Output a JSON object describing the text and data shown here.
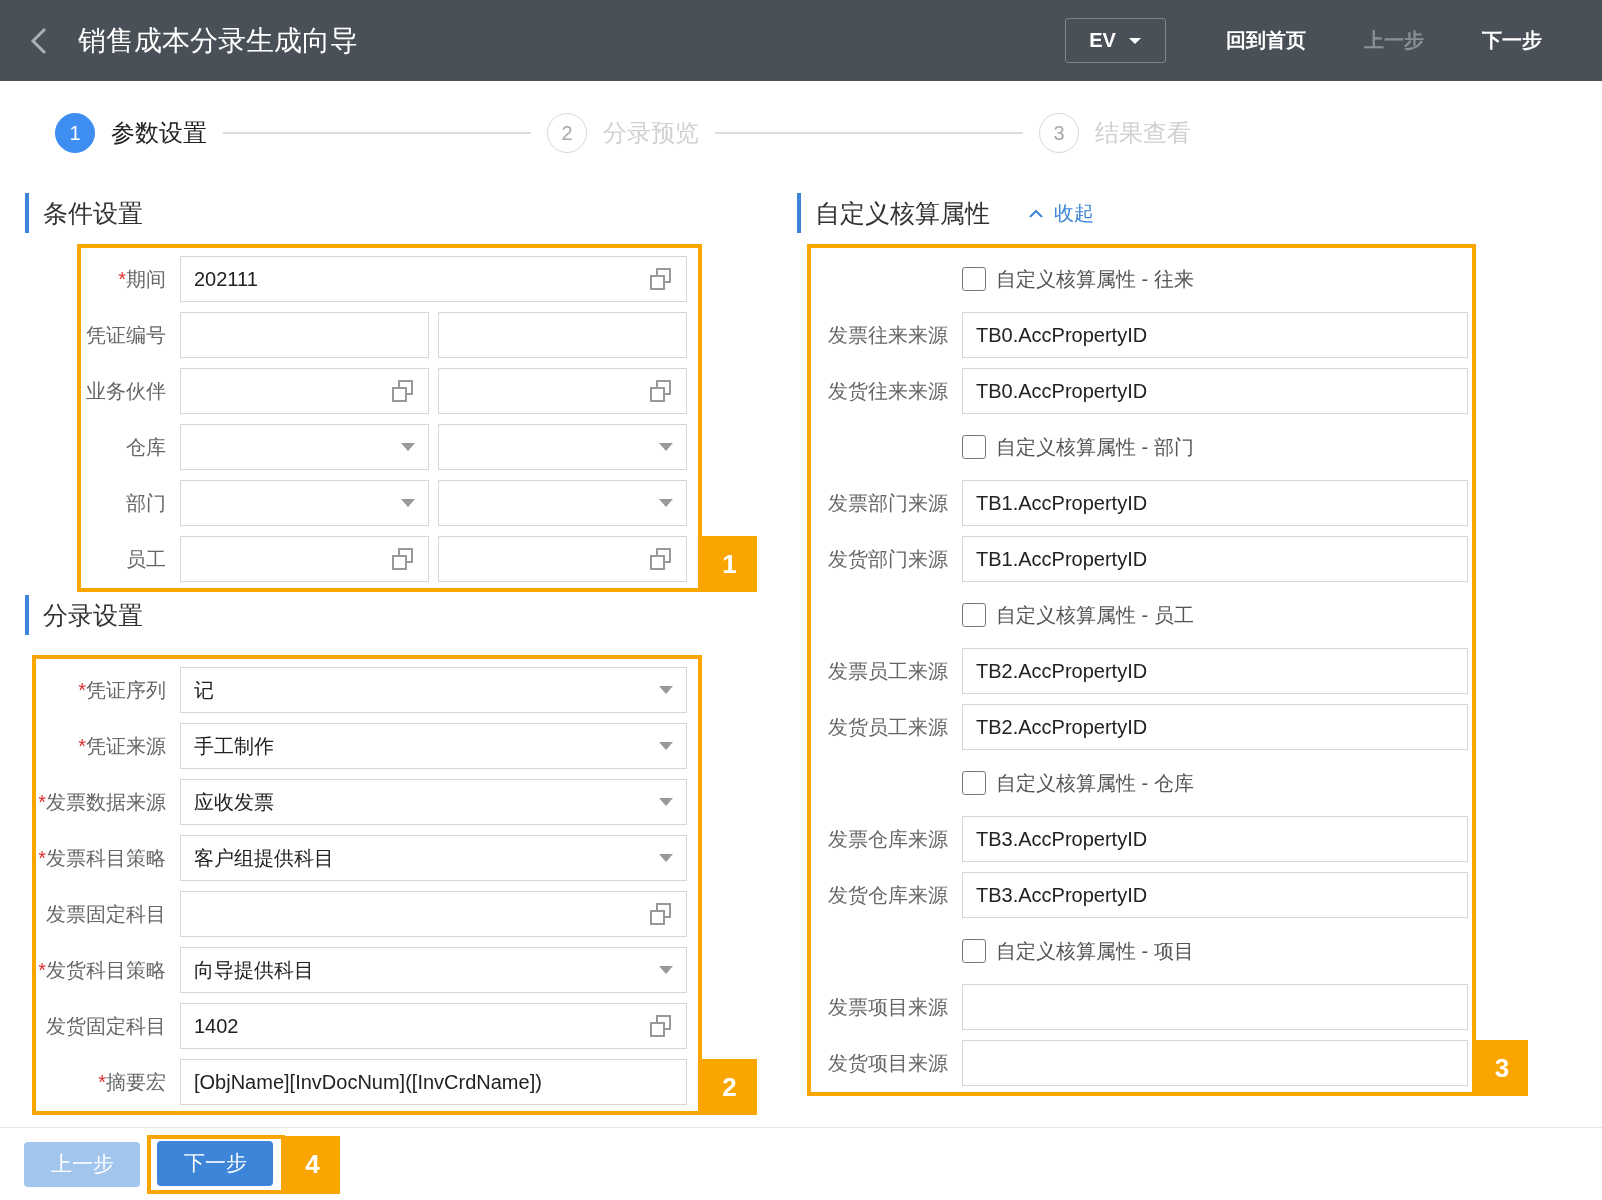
{
  "header": {
    "title": "销售成本分录生成向导",
    "org_select": "EV",
    "nav": [
      {
        "label": "回到首页",
        "disabled": false
      },
      {
        "label": "上一步",
        "disabled": true
      },
      {
        "label": "下一步",
        "disabled": false
      }
    ]
  },
  "steps": [
    {
      "number": "1",
      "label": "参数设置",
      "selected": true
    },
    {
      "number": "2",
      "label": "分录预览",
      "selected": false
    },
    {
      "number": "3",
      "label": "结果查看",
      "selected": false
    }
  ],
  "condition_section": {
    "title": "条件设置",
    "callout": "1",
    "rows": [
      {
        "label": "期间",
        "marker": "*",
        "fields": [
          {
            "kind": "lookup",
            "value": "202111"
          }
        ]
      },
      {
        "label": "凭证编号",
        "fields": [
          {
            "kind": "text"
          },
          {
            "kind": "text"
          }
        ]
      },
      {
        "label": "业务伙伴",
        "fields": [
          {
            "kind": "lookup"
          },
          {
            "kind": "lookup"
          }
        ]
      },
      {
        "label": "仓库",
        "fields": [
          {
            "kind": "select"
          },
          {
            "kind": "select"
          }
        ]
      },
      {
        "label": "部门",
        "fields": [
          {
            "kind": "select"
          },
          {
            "kind": "select"
          }
        ]
      },
      {
        "label": "员工",
        "fields": [
          {
            "kind": "lookup"
          },
          {
            "kind": "lookup"
          }
        ]
      }
    ]
  },
  "entry_section": {
    "title": "分录设置",
    "callout": "2",
    "rows": [
      {
        "label": "凭证序列",
        "marker": "*",
        "fields": [
          {
            "kind": "select",
            "value": "记"
          }
        ]
      },
      {
        "label": "凭证来源",
        "marker": "*",
        "fields": [
          {
            "kind": "select",
            "value": "手工制作"
          }
        ]
      },
      {
        "label": "发票数据来源",
        "marker": "*",
        "fields": [
          {
            "kind": "select",
            "value": "应收发票"
          }
        ]
      },
      {
        "label": "发票科目策略",
        "marker": "*",
        "fields": [
          {
            "kind": "select",
            "value": "客户组提供科目"
          }
        ]
      },
      {
        "label": "发票固定科目",
        "fields": [
          {
            "kind": "lookup"
          }
        ]
      },
      {
        "label": "发货科目策略",
        "marker": "*",
        "fields": [
          {
            "kind": "select",
            "value": "向导提供科目"
          }
        ]
      },
      {
        "label": "发货固定科目",
        "fields": [
          {
            "kind": "lookup",
            "value": "1402"
          }
        ]
      },
      {
        "label": "摘要宏",
        "marker": "*",
        "fields": [
          {
            "kind": "text",
            "value": "[ObjName][InvDocNum]([InvCrdName])"
          }
        ]
      }
    ]
  },
  "custom_section": {
    "title": "自定义核算属性",
    "toggle": "收起",
    "callout": "3",
    "rows": [
      {
        "kind": "checkbox",
        "label": "自定义核算属性 - 往来",
        "checked": false
      },
      {
        "kind": "field",
        "label": "发票往来来源",
        "value": "TB0.AccPropertyID"
      },
      {
        "kind": "field",
        "label": "发货往来来源",
        "value": "TB0.AccPropertyID"
      },
      {
        "kind": "checkbox",
        "label": "自定义核算属性 - 部门",
        "checked": false
      },
      {
        "kind": "field",
        "label": "发票部门来源",
        "value": "TB1.AccPropertyID"
      },
      {
        "kind": "field",
        "label": "发货部门来源",
        "value": "TB1.AccPropertyID"
      },
      {
        "kind": "checkbox",
        "label": "自定义核算属性 - 员工",
        "checked": false
      },
      {
        "kind": "field",
        "label": "发票员工来源",
        "value": "TB2.AccPropertyID"
      },
      {
        "kind": "field",
        "label": "发货员工来源",
        "value": "TB2.AccPropertyID"
      },
      {
        "kind": "checkbox",
        "label": "自定义核算属性 - 仓库",
        "checked": false
      },
      {
        "kind": "field",
        "label": "发票仓库来源",
        "value": "TB3.AccPropertyID"
      },
      {
        "kind": "field",
        "label": "发货仓库来源",
        "value": "TB3.AccPropertyID"
      },
      {
        "kind": "checkbox",
        "label": "自定义核算属性 - 项目",
        "checked": false
      },
      {
        "kind": "field",
        "label": "发票项目来源"
      },
      {
        "kind": "field",
        "label": "发货项目来源"
      }
    ]
  },
  "footer": {
    "buttons": [
      {
        "label": "上一步",
        "disabled": true
      },
      {
        "label": "下一步",
        "disabled": false,
        "callout": "4"
      }
    ]
  }
}
